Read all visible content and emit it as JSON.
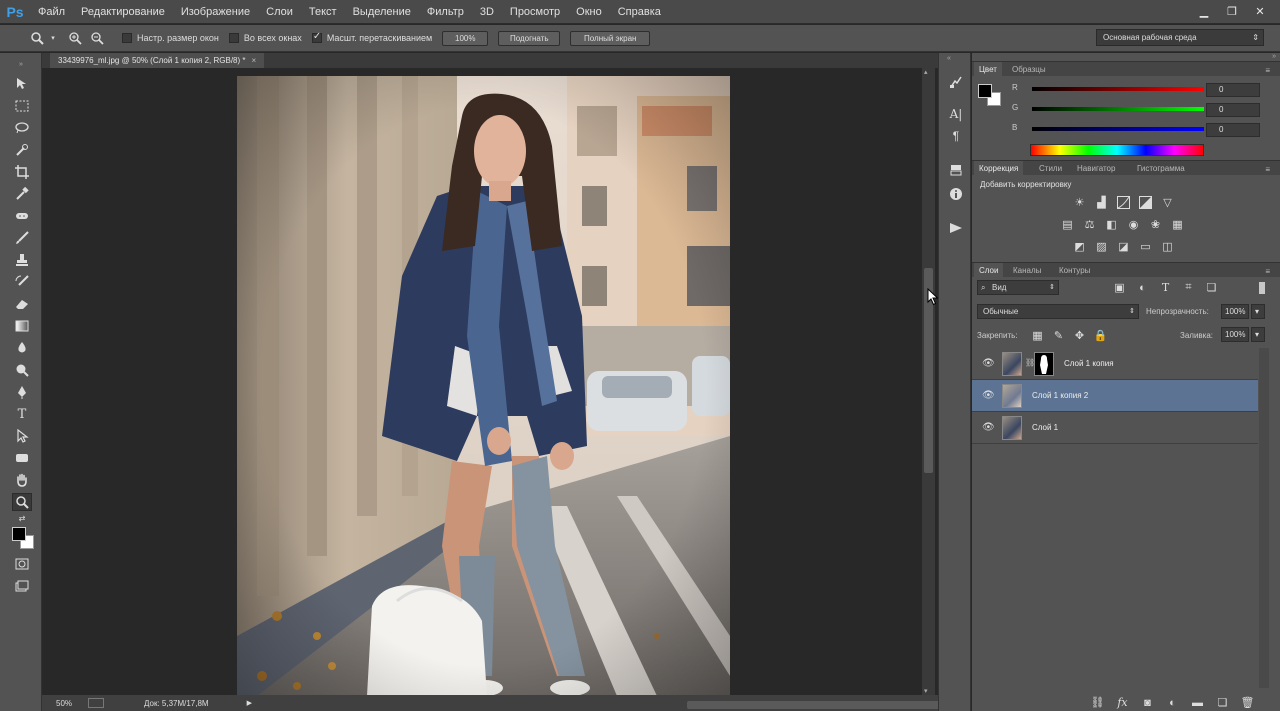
{
  "app": {
    "logo": "Ps"
  },
  "menu": [
    "Файл",
    "Редактирование",
    "Изображение",
    "Слои",
    "Текст",
    "Выделение",
    "Фильтр",
    "3D",
    "Просмотр",
    "Окно",
    "Справка"
  ],
  "options": {
    "resize_windows": "Настр. размер окон",
    "all_windows": "Во всех окнах",
    "scrubby_zoom": "Масшт. перетаскиванием",
    "zoom_value": "100%",
    "fit_label": "Подогнать",
    "fullscreen_label": "Полный экран",
    "workspace": "Основная рабочая среда"
  },
  "document": {
    "tab_title": "33439976_ml.jpg @ 50% (Слой 1 копия 2, RGB/8) *",
    "close": "×"
  },
  "status": {
    "zoom": "50%",
    "doc_info": "Док: 5,37M/17,8M"
  },
  "color_panel": {
    "tabs": [
      "Цвет",
      "Образцы"
    ],
    "r_label": "R",
    "g_label": "G",
    "b_label": "B",
    "r": "0",
    "g": "0",
    "b": "0"
  },
  "adjust_panel": {
    "tabs": [
      "Коррекция",
      "Стили",
      "Навигатор",
      "Гистограмма"
    ],
    "title": "Добавить корректировку"
  },
  "layers_panel": {
    "tabs": [
      "Слои",
      "Каналы",
      "Контуры"
    ],
    "filter": "Вид",
    "blend_mode": "Обычные",
    "opacity_label": "Непрозрачность:",
    "opacity": "100%",
    "lock_label": "Закрепить:",
    "fill_label": "Заливка:",
    "fill": "100%",
    "layers": [
      {
        "name": "Слой 1 копия",
        "selected": false
      },
      {
        "name": "Слой 1 копия 2",
        "selected": true
      },
      {
        "name": "Слой 1",
        "selected": false
      }
    ]
  },
  "colors": {
    "accent": "#3fa0e8",
    "selection": "#5c7393",
    "background": "#282828",
    "panel": "#535353"
  }
}
